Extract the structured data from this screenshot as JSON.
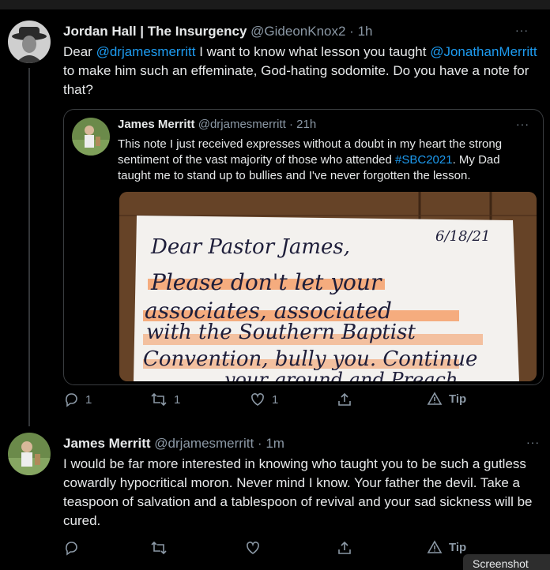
{
  "tweet1": {
    "name": "Jordan Hall | The Insurgency",
    "handle": "@GideonKnox2",
    "sep": "·",
    "time": "1h",
    "more": "···",
    "text1": "Dear ",
    "mention1": "@drjamesmerritt",
    "text2": " I want to know what lesson you taught ",
    "mention2": "@JonathanMerritt",
    "text3": " to make him such an effeminate, God-hating sodomite. Do you have a note for that?",
    "quote": {
      "name": "James Merritt",
      "handle": "@drjamesmerritt",
      "sep": "·",
      "time": "21h",
      "more": "···",
      "text1": "This note I just received expresses without a doubt in my heart the strong sentiment of the vast majority of those who attended ",
      "hashtag": "#SBC2021",
      "text2": ". My Dad taught me to stand up to bullies and I've never forgotten the lesson.",
      "note": {
        "line1": "Dear Pastor James,",
        "date": "6/18/21",
        "line2": "Please don't let your",
        "line3": "associates, associated",
        "line4": "with the Southern Baptist",
        "line5": "Convention, bully you. Continue",
        "line6": "...your ground and Preach"
      }
    },
    "reply_count": "1",
    "retweet_count": "1",
    "like_count": "1",
    "tip_label": "Tip"
  },
  "tweet2": {
    "name": "James Merritt",
    "handle": "@drjamesmerritt",
    "sep": "·",
    "time": "1m",
    "more": "···",
    "text": "I would be far more interested in knowing who taught you to be such a gutless cowardly hypocritical moron. Never mind I know. Your father the devil. Take a teaspoon of salvation and a tablespoon of revival and your sad sickness will be cured.",
    "tip_label": "Tip"
  },
  "badge": "Screenshot",
  "icons": [
    "reply-icon",
    "retweet-icon",
    "like-icon",
    "share-icon",
    "tip-icon",
    "more-icon"
  ],
  "colors": {
    "link": "#1d9bf0",
    "muted": "#8b98a5",
    "highlight": "#f4a06a"
  }
}
